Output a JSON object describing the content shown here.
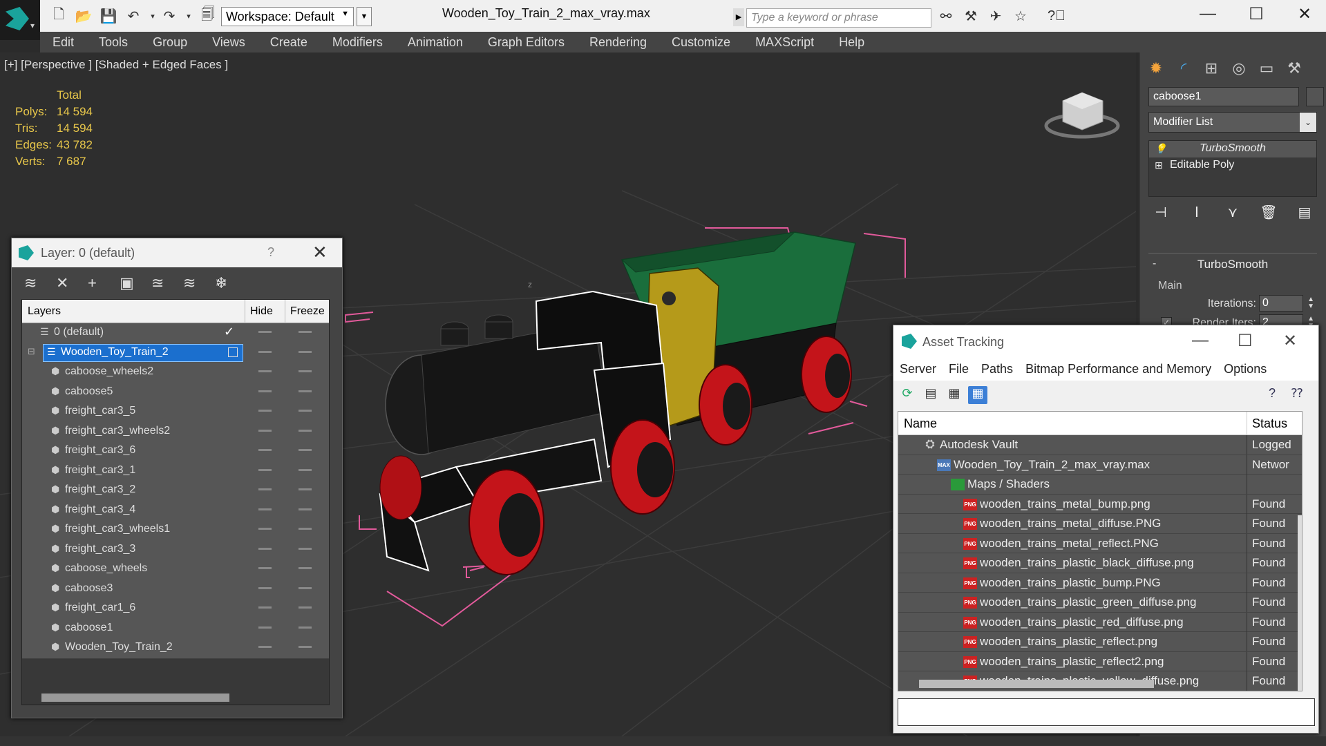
{
  "titlebar": {
    "workspace": "Workspace: Default",
    "file_title": "Wooden_Toy_Train_2_max_vray.max",
    "search_placeholder": "Type a keyword or phrase"
  },
  "menu": [
    "Edit",
    "Tools",
    "Group",
    "Views",
    "Create",
    "Modifiers",
    "Animation",
    "Graph Editors",
    "Rendering",
    "Customize",
    "MAXScript",
    "Help"
  ],
  "viewport": {
    "label": "[+] [Perspective ] [Shaded + Edged Faces ]",
    "stats_header": "Total",
    "stats": [
      {
        "label": "Polys:",
        "value": "14 594"
      },
      {
        "label": "Tris:",
        "value": "14 594"
      },
      {
        "label": "Edges:",
        "value": "43 782"
      },
      {
        "label": "Verts:",
        "value": "7 687"
      }
    ]
  },
  "command_panel": {
    "object_name": "caboose1",
    "modifier_list": "Modifier List",
    "stack": [
      "TurboSmooth",
      "Editable Poly"
    ],
    "rollout_title": "TurboSmooth",
    "main_label": "Main",
    "iterations_label": "Iterations:",
    "iterations_value": "0",
    "render_iters_label": "Render Iters:",
    "render_iters_value": "2"
  },
  "layer_dialog": {
    "title": "Layer: 0 (default)",
    "help": "?",
    "columns": {
      "layers": "Layers",
      "hide": "Hide",
      "freeze": "Freeze"
    },
    "default_layer": "0 (default)",
    "active_layer": "Wooden_Toy_Train_2",
    "objects": [
      "caboose_wheels2",
      "caboose5",
      "freight_car3_5",
      "freight_car3_wheels2",
      "freight_car3_6",
      "freight_car3_1",
      "freight_car3_2",
      "freight_car3_4",
      "freight_car3_wheels1",
      "freight_car3_3",
      "caboose_wheels",
      "caboose3",
      "freight_car1_6",
      "caboose1",
      "Wooden_Toy_Train_2"
    ]
  },
  "asset_dialog": {
    "title": "Asset Tracking",
    "menu": [
      "Server",
      "File",
      "Paths",
      "Bitmap Performance and Memory",
      "Options"
    ],
    "columns": {
      "name": "Name",
      "status": "Status"
    },
    "vault": {
      "name": "Autodesk Vault",
      "status": "Logged"
    },
    "file": {
      "name": "Wooden_Toy_Train_2_max_vray.max",
      "status": "Networ"
    },
    "maps_group": "Maps / Shaders",
    "maps": [
      {
        "name": "wooden_trains_metal_bump.png",
        "status": "Found"
      },
      {
        "name": "wooden_trains_metal_diffuse.PNG",
        "status": "Found"
      },
      {
        "name": "wooden_trains_metal_reflect.PNG",
        "status": "Found"
      },
      {
        "name": "wooden_trains_plastic_black_diffuse.png",
        "status": "Found"
      },
      {
        "name": "wooden_trains_plastic_bump.PNG",
        "status": "Found"
      },
      {
        "name": "wooden_trains_plastic_green_diffuse.png",
        "status": "Found"
      },
      {
        "name": "wooden_trains_plastic_red_diffuse.png",
        "status": "Found"
      },
      {
        "name": "wooden_trains_plastic_reflect.png",
        "status": "Found"
      },
      {
        "name": "wooden_trains_plastic_reflect2.png",
        "status": "Found"
      },
      {
        "name": "wooden_trains_plastic_yellow_diffuse.png",
        "status": "Found"
      }
    ],
    "png_badge": "PNG",
    "max_badge": "MAX"
  },
  "colors": {
    "stats_text": "#e8c74a",
    "selection": "#1b6fce",
    "wheel_red": "#c4141a",
    "car_green": "#1a6e3c",
    "car_yellow": "#b59a1a"
  }
}
